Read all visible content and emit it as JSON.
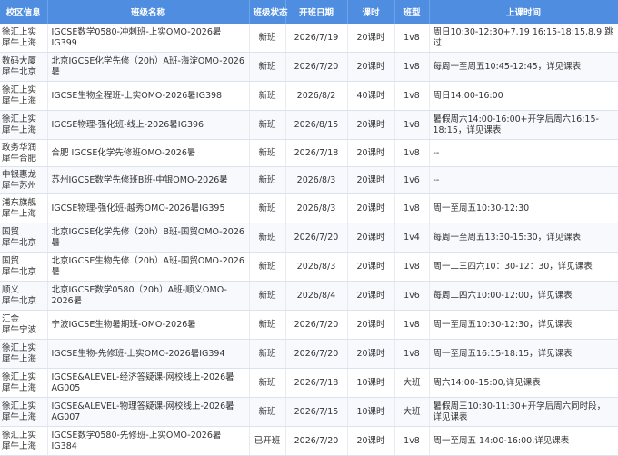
{
  "table": {
    "headers": [
      "校区信息",
      "班级名称",
      "班级状态",
      "开班日期",
      "课时",
      "班型",
      "上课时间"
    ],
    "rows": [
      {
        "campus": [
          "徐汇上实",
          "犀牛上海"
        ],
        "name": "IGCSE数学0580-冲刺班-上实OMO-2026暑IG399",
        "status": "新班",
        "date": "2026/7/19",
        "hours": "20课时",
        "type": "1v8",
        "schedule": "周日10:30-12:30+7.19 16:15-18:15,8.9 跳过"
      },
      {
        "campus": [
          "数码大厦",
          "犀牛北京"
        ],
        "name": "北京IGCSE化学先修（20h）A班-海淀OMO-2026暑",
        "status": "新班",
        "date": "2026/7/20",
        "hours": "20课时",
        "type": "1v8",
        "schedule": "每周一至周五10:45-12:45，详见课表"
      },
      {
        "campus": [
          "徐汇上实",
          "犀牛上海"
        ],
        "name": "IGCSE生物全程班-上实OMO-2026暑IG398",
        "status": "新班",
        "date": "2026/8/2",
        "hours": "40课时",
        "type": "1v8",
        "schedule": "周日14:00-16:00"
      },
      {
        "campus": [
          "徐汇上实",
          "犀牛上海"
        ],
        "name": "IGCSE物理-强化班-线上-2026暑IG396",
        "status": "新班",
        "date": "2026/8/15",
        "hours": "20课时",
        "type": "1v8",
        "schedule": "暑假周六14:00-16:00+开学后周六16:15-18:15，详见课表"
      },
      {
        "campus": [
          "政务华润",
          "犀牛合肥"
        ],
        "name": "合肥 IGCSE化学先修班OMO-2026暑",
        "status": "新班",
        "date": "2026/7/18",
        "hours": "20课时",
        "type": "1v8",
        "schedule": "--"
      },
      {
        "campus": [
          "中银惠龙",
          "犀牛苏州"
        ],
        "name": "苏州IGCSE数学先修班B班-中银OMO-2026暑",
        "status": "新班",
        "date": "2026/8/3",
        "hours": "20课时",
        "type": "1v6",
        "schedule": "--"
      },
      {
        "campus": [
          "浦东旗舰",
          "犀牛上海"
        ],
        "name": "IGCSE物理-强化班-越秀OMO-2026暑IG395",
        "status": "新班",
        "date": "2026/8/3",
        "hours": "20课时",
        "type": "1v8",
        "schedule": "周一至周五10:30-12:30"
      },
      {
        "campus": [
          "国贸",
          "犀牛北京"
        ],
        "name": "北京IGCSE化学先修（20h）B班-国贸OMO-2026暑",
        "status": "新班",
        "date": "2026/7/20",
        "hours": "20课时",
        "type": "1v4",
        "schedule": "每周一至周五13:30-15:30，详见课表"
      },
      {
        "campus": [
          "国贸",
          "犀牛北京"
        ],
        "name": "北京IGCSE生物先修（20h）A班-国贸OMO-2026暑",
        "status": "新班",
        "date": "2026/8/3",
        "hours": "20课时",
        "type": "1v8",
        "schedule": "周一二三四六10：30-12：30，详见课表"
      },
      {
        "campus": [
          "顺义",
          "犀牛北京"
        ],
        "name": "北京IGCSE数学0580（20h）A班-顺义OMO-2026暑",
        "status": "新班",
        "date": "2026/8/4",
        "hours": "20课时",
        "type": "1v6",
        "schedule": "每周二四六10:00-12:00，详见课表"
      },
      {
        "campus": [
          "汇金",
          "犀牛宁波"
        ],
        "name": "宁波IGCSE生物暑期班-OMO-2026暑",
        "status": "新班",
        "date": "2026/7/20",
        "hours": "20课时",
        "type": "1v8",
        "schedule": "周一至周五10:30-12:30，详见课表"
      },
      {
        "campus": [
          "徐汇上实",
          "犀牛上海"
        ],
        "name": "IGCSE生物-先修班-上实OMO-2026暑IG394",
        "status": "新班",
        "date": "2026/7/20",
        "hours": "20课时",
        "type": "1v8",
        "schedule": "周一至周五16:15-18:15，详见课表"
      },
      {
        "campus": [
          "徐汇上实",
          "犀牛上海"
        ],
        "name": "IGCSE&ALEVEL-经济答疑课-网校线上-2026暑AG005",
        "status": "新班",
        "date": "2026/7/18",
        "hours": "10课时",
        "type": "大班",
        "schedule": "周六14:00-15:00,详见课表"
      },
      {
        "campus": [
          "徐汇上实",
          "犀牛上海"
        ],
        "name": "IGCSE&ALEVEL-物理答疑课-网校线上-2026暑AG007",
        "status": "新班",
        "date": "2026/7/15",
        "hours": "10课时",
        "type": "大班",
        "schedule": "暑假周三10:30-11:30+开学后周六同时段，详见课表"
      },
      {
        "campus": [
          "徐汇上实",
          "犀牛上海"
        ],
        "name": "IGCSE数学0580-先修班-上实OMO-2026暑IG384",
        "status": "已开班",
        "date": "2026/7/20",
        "hours": "20课时",
        "type": "1v8",
        "schedule": "周一至周五 14:00-16:00,详见课表"
      }
    ]
  }
}
